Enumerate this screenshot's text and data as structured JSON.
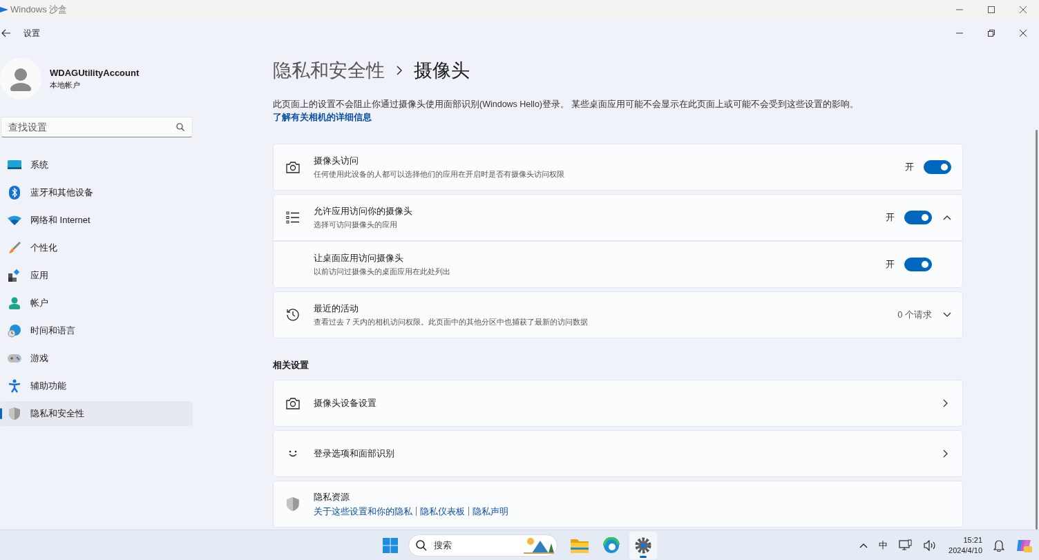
{
  "sandbox": {
    "title": "Windows 沙盒"
  },
  "app": {
    "title": "设置"
  },
  "account": {
    "name": "WDAGUtilityAccount",
    "type": "本地帐户"
  },
  "search": {
    "placeholder": "查找设置"
  },
  "nav": [
    {
      "label": "系统",
      "selected": false
    },
    {
      "label": "蓝牙和其他设备",
      "selected": false
    },
    {
      "label": "网络和 Internet",
      "selected": false
    },
    {
      "label": "个性化",
      "selected": false
    },
    {
      "label": "应用",
      "selected": false
    },
    {
      "label": "帐户",
      "selected": false
    },
    {
      "label": "时间和语言",
      "selected": false
    },
    {
      "label": "游戏",
      "selected": false
    },
    {
      "label": "辅助功能",
      "selected": false
    },
    {
      "label": "隐私和安全性",
      "selected": true
    }
  ],
  "breadcrumb": {
    "parent": "隐私和安全性",
    "current": "摄像头"
  },
  "intro": {
    "text": "此页面上的设置不会阻止你通过摄像头使用面部识别(Windows Hello)登录。 某些桌面应用可能不会显示在此页面上或可能不会受到这些设置的影响。",
    "link": "了解有关相机的详细信息"
  },
  "settings": [
    {
      "kind": "toggle",
      "title": "摄像头访问",
      "subtitle": "任何使用此设备的人都可以选择他们的应用在开启时是否有摄像头访问权限",
      "state_label": "开",
      "on": true
    },
    {
      "kind": "group",
      "title": "允许应用访问你的摄像头",
      "subtitle": "选择可访问摄像头的应用",
      "state_label": "开",
      "on": true,
      "expanded": true,
      "children": [
        {
          "title": "让桌面应用访问摄像头",
          "subtitle": "以前访问过摄像头的桌面应用在此处列出",
          "state_label": "开",
          "on": true
        }
      ]
    },
    {
      "kind": "expander",
      "title": "最近的活动",
      "subtitle": "查看过去 7 天内的相机访问权限。此页面中的其他分区中也捕获了最新的访问数据",
      "value": "0 个请求",
      "expanded": false
    }
  ],
  "related": {
    "heading": "相关设置",
    "items": [
      {
        "kind": "link",
        "title": "摄像头设备设置"
      },
      {
        "kind": "link",
        "title": "登录选项和面部识别"
      },
      {
        "kind": "links",
        "title": "隐私资源",
        "links": [
          "关于这些设置和你的隐私",
          "隐私仪表板",
          "隐私声明"
        ]
      }
    ]
  },
  "taskbar": {
    "search_placeholder": "搜索",
    "apps": [
      {
        "kind": "folder",
        "selected": false
      },
      {
        "kind": "edge",
        "selected": false
      },
      {
        "kind": "settings",
        "selected": true
      }
    ],
    "ime": "中",
    "time": "15:21",
    "date": "2024/4/10"
  }
}
